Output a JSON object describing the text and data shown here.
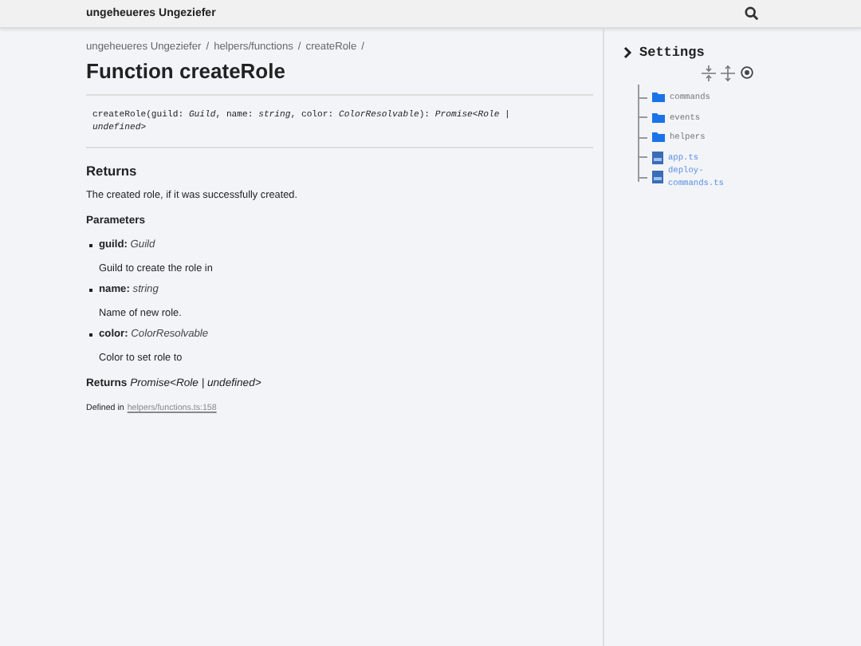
{
  "header": {
    "title": "ungeheueres Ungeziefer"
  },
  "breadcrumbs": [
    {
      "label": "ungeheueres Ungeziefer",
      "separator": "/"
    },
    {
      "label": "helpers/functions",
      "separator": "/"
    },
    {
      "label": "createRole",
      "separator": "/"
    }
  ],
  "title": "Function createRole",
  "signature": "createRole(guild: *Guild*, name: *string*, color: *ColorResolvable*): *Promise<Role | undefined>*",
  "returns_heading": "Returns",
  "returns_text": "The created role, if it was successfully created.",
  "parameters_heading": "Parameters",
  "parameters": [
    {
      "name": "guild:",
      "type": "Guild",
      "description": "Guild to create the role in"
    },
    {
      "name": "name:",
      "type": "string",
      "description": "Name of new role."
    },
    {
      "name": "color:",
      "type": "ColorResolvable",
      "description": "Color to set role to"
    }
  ],
  "returns_label": "Returns",
  "returns_type": "Promise<Role | undefined>",
  "defined_in": {
    "label": "Defined in",
    "link": "helpers/functions.ts:158"
  },
  "sidebar": {
    "settings": "Settings",
    "tree": [
      {
        "kind": "folder",
        "label": "commands"
      },
      {
        "kind": "folder",
        "label": "events"
      },
      {
        "kind": "folder",
        "label": "helpers"
      },
      {
        "kind": "file",
        "label": "app.ts"
      },
      {
        "kind": "file",
        "label": "deploy-commands.ts"
      }
    ]
  }
}
